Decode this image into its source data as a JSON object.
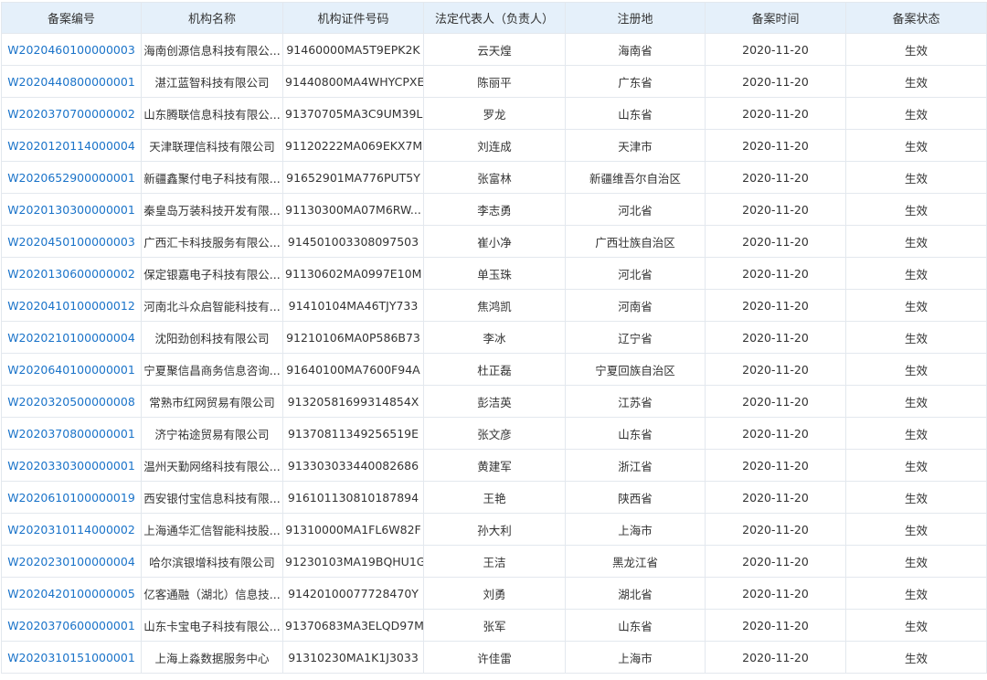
{
  "columns": [
    "备案编号",
    "机构名称",
    "机构证件号码",
    "法定代表人（负责人）",
    "注册地",
    "备案时间",
    "备案状态"
  ],
  "rows": [
    [
      "W2020460100000003",
      "海南创源信息科技有限公...",
      "91460000MA5T9EPK2K",
      "云天煌",
      "海南省",
      "2020-11-20",
      "生效"
    ],
    [
      "W2020440800000001",
      "湛江蓝智科技有限公司",
      "91440800MA4WHYCPXE",
      "陈丽平",
      "广东省",
      "2020-11-20",
      "生效"
    ],
    [
      "W2020370700000002",
      "山东腾联信息科技有限公...",
      "91370705MA3C9UM39L",
      "罗龙",
      "山东省",
      "2020-11-20",
      "生效"
    ],
    [
      "W2020120114000004",
      "天津联理信科技有限公司",
      "91120222MA069EKX7M",
      "刘连成",
      "天津市",
      "2020-11-20",
      "生效"
    ],
    [
      "W2020652900000001",
      "新疆鑫聚付电子科技有限...",
      "91652901MA776PUT5Y",
      "张富林",
      "新疆维吾尔自治区",
      "2020-11-20",
      "生效"
    ],
    [
      "W2020130300000001",
      "秦皇岛万装科技开发有限...",
      "91130300MA07M6RW...",
      "李志勇",
      "河北省",
      "2020-11-20",
      "生效"
    ],
    [
      "W2020450100000003",
      "广西汇卡科技服务有限公...",
      "914501003308097503",
      "崔小净",
      "广西壮族自治区",
      "2020-11-20",
      "生效"
    ],
    [
      "W2020130600000002",
      "保定银嘉电子科技有限公...",
      "91130602MA0997E10M",
      "单玉珠",
      "河北省",
      "2020-11-20",
      "生效"
    ],
    [
      "W2020410100000012",
      "河南北斗众启智能科技有...",
      "91410104MA46TJY733",
      "焦鸿凯",
      "河南省",
      "2020-11-20",
      "生效"
    ],
    [
      "W2020210100000004",
      "沈阳劲创科技有限公司",
      "91210106MA0P586B73",
      "李冰",
      "辽宁省",
      "2020-11-20",
      "生效"
    ],
    [
      "W2020640100000001",
      "宁夏聚信昌商务信息咨询...",
      "91640100MA7600F94A",
      "杜正磊",
      "宁夏回族自治区",
      "2020-11-20",
      "生效"
    ],
    [
      "W2020320500000008",
      "常熟市红网贸易有限公司",
      "91320581699314854X",
      "彭洁英",
      "江苏省",
      "2020-11-20",
      "生效"
    ],
    [
      "W2020370800000001",
      "济宁祐途贸易有限公司",
      "91370811349256519E",
      "张文彦",
      "山东省",
      "2020-11-20",
      "生效"
    ],
    [
      "W2020330300000001",
      "温州天勤网络科技有限公...",
      "913303033440082686",
      "黄建军",
      "浙江省",
      "2020-11-20",
      "生效"
    ],
    [
      "W2020610100000019",
      "西安银付宝信息科技有限...",
      "916101130810187894",
      "王艳",
      "陕西省",
      "2020-11-20",
      "生效"
    ],
    [
      "W2020310114000002",
      "上海通华汇信智能科技股...",
      "91310000MA1FL6W82F",
      "孙大利",
      "上海市",
      "2020-11-20",
      "生效"
    ],
    [
      "W2020230100000004",
      "哈尔滨银增科技有限公司",
      "91230103MA19BQHU1G",
      "王洁",
      "黑龙江省",
      "2020-11-20",
      "生效"
    ],
    [
      "W2020420100000005",
      "亿客通融（湖北）信息技...",
      "91420100077728470Y",
      "刘勇",
      "湖北省",
      "2020-11-20",
      "生效"
    ],
    [
      "W2020370600000001",
      "山东卡宝电子科技有限公...",
      "91370683MA3ELQD97M",
      "张军",
      "山东省",
      "2020-11-20",
      "生效"
    ],
    [
      "W2020310151000001",
      "上海上淼数据服务中心",
      "91310230MA1K1J3033",
      "许佳雷",
      "上海市",
      "2020-11-20",
      "生效"
    ]
  ]
}
